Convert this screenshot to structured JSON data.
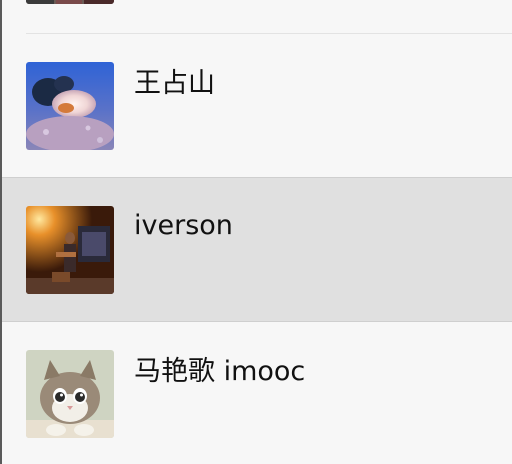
{
  "chat_list": {
    "items": [
      {
        "name": "",
        "avatar": "avatar-partial-icon",
        "selected": false
      },
      {
        "name": "王占山",
        "avatar": "sea-anemone-avatar",
        "selected": false
      },
      {
        "name": "iverson",
        "avatar": "stage-performer-avatar",
        "selected": true
      },
      {
        "name": "马艳歌 imooc",
        "avatar": "cat-avatar",
        "selected": false
      }
    ]
  },
  "colors": {
    "background": "#f7f7f7",
    "selected_background": "#e0e0e0",
    "text": "#111111",
    "divider": "#e3e3e3"
  }
}
